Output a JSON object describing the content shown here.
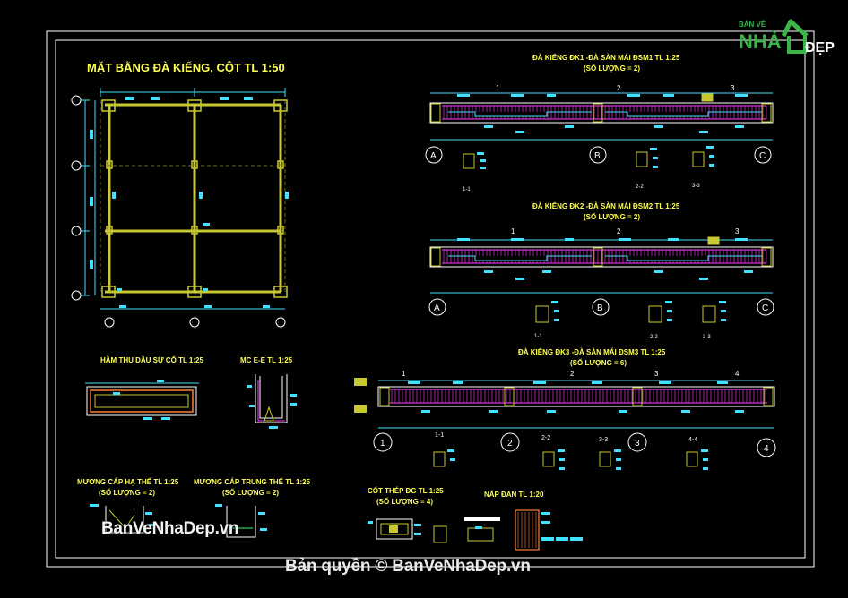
{
  "titles": {
    "main": "MẶT BẰNG ĐÀ KIỂNG, CỘT  TL 1:50",
    "dk1": "ĐÀ KIỂNG ĐK1 -ĐÀ SÀN MÁI ĐSM1 TL 1:25",
    "dk1_qty": "(SỐ LƯỢNG = 2)",
    "dk2": "ĐÀ KIỂNG ĐK2 -ĐÀ SÀN MÁI ĐSM2 TL 1:25",
    "dk2_qty": "(SỐ LƯỢNG = 2)",
    "dk3": "ĐÀ KIỂNG ĐK3 -ĐÀ SÀN MÁI ĐSM3 TL 1:25",
    "dk3_qty": "(SỐ LƯỢNG = 6)",
    "ham": "HẦM THU DẦU SỰ CỐ TL 1:25",
    "mc": "MC E-E TL 1:25",
    "muong_ha": "MƯƠNG CÁP HẠ THẾ TL 1:25",
    "muong_ha_qty": "(SỐ LƯỢNG = 2)",
    "muong_trung": "MƯƠNG CÁP TRUNG THẾ TL 1:25",
    "muong_trung_qty": "(SỐ LƯỢNG = 2)",
    "cot_thep": "CỐT THÉP  ĐG TL 1:25",
    "cot_thep_qty": "(SỐ LƯỢNG = 4)",
    "nap_dan": "NẮP ĐAN TL 1:20"
  },
  "axes": {
    "dk1": [
      "A",
      "B",
      "C"
    ],
    "dk2": [
      "A",
      "B",
      "C"
    ],
    "dk3": [
      "1",
      "2",
      "3",
      "4"
    ]
  },
  "section_labels": {
    "dk1": [
      "1-1",
      "2-2",
      "3-3"
    ],
    "dk2": [
      "1-1",
      "2-2",
      "3-3"
    ],
    "dk3": [
      "1-1",
      "2-2",
      "3-3",
      "4-4"
    ]
  },
  "cut_marks": {
    "dk1": [
      "1",
      "2",
      "3"
    ],
    "dk2": [
      "1",
      "2",
      "3"
    ],
    "dk3": [
      "1",
      "2",
      "3",
      "4"
    ]
  },
  "logo": {
    "line1": "BẢN VẼ",
    "line2": "NHÀ",
    "line3": "ĐẸP"
  },
  "watermarks": {
    "corner": "BanVeNhaDep.vn",
    "bottom": "Bản quyền © BanVeNhaDep.vn"
  },
  "colors": {
    "background": "#000000",
    "frame": "#ffffff",
    "title": "#ffff55",
    "dimension": "#40e0ff",
    "beam": "#ff40ff",
    "column": "#c8c830"
  }
}
